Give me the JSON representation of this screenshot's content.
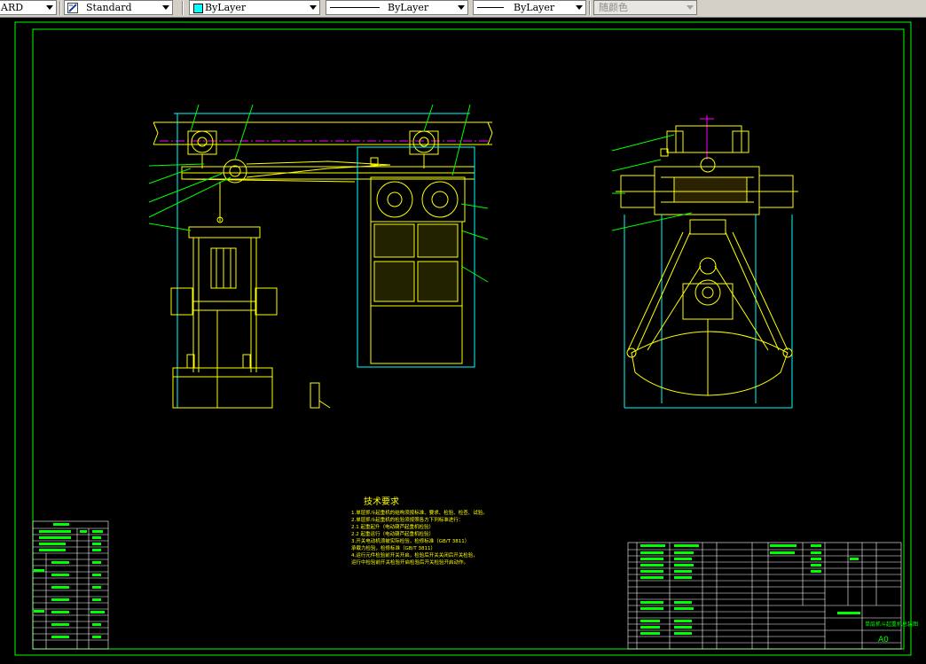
{
  "toolbar": {
    "text_style": {
      "value": "ARD"
    },
    "dim_style": {
      "value": "Standard",
      "icon": "dimension-style-icon"
    },
    "layer": {
      "value": "ByLayer",
      "swatch_color": "#00ffff"
    },
    "linetype": {
      "value": "ByLayer"
    },
    "lineweight": {
      "value": "ByLayer"
    },
    "plot_style": {
      "value": "随颜色"
    }
  },
  "drawing": {
    "background": "#000000",
    "frame_color": "#00ff00",
    "geometry_color": "#ffff00",
    "rail_color": "#ff00ff",
    "extension_color": "#00ffff",
    "notes_title": "技术要求",
    "notes": [
      "1.单层抓斗起重机的结构须按标准、要求、检验、检查、试验。",
      "2.单层抓斗起重机的检验须按照各方下列标准进行：",
      "2.1 起重起升（电动葫芦起重机检验）",
      "2.2 起重运行（电动葫芦起重机检验）",
      "3.开关电动机须被实际检验，检修标准（GB/T 3811）",
      "  承载力检验，检修标准（GB/T 3811）",
      "4.运行元件检验前开关开启，检验后开关关闭后开关检验，",
      "  运行中检验前开关检验开启检验后开关检验开启动作。"
    ],
    "title_block": {
      "drawing_name": "单层抓斗起重机总装图",
      "sheet_size": "A0"
    }
  }
}
